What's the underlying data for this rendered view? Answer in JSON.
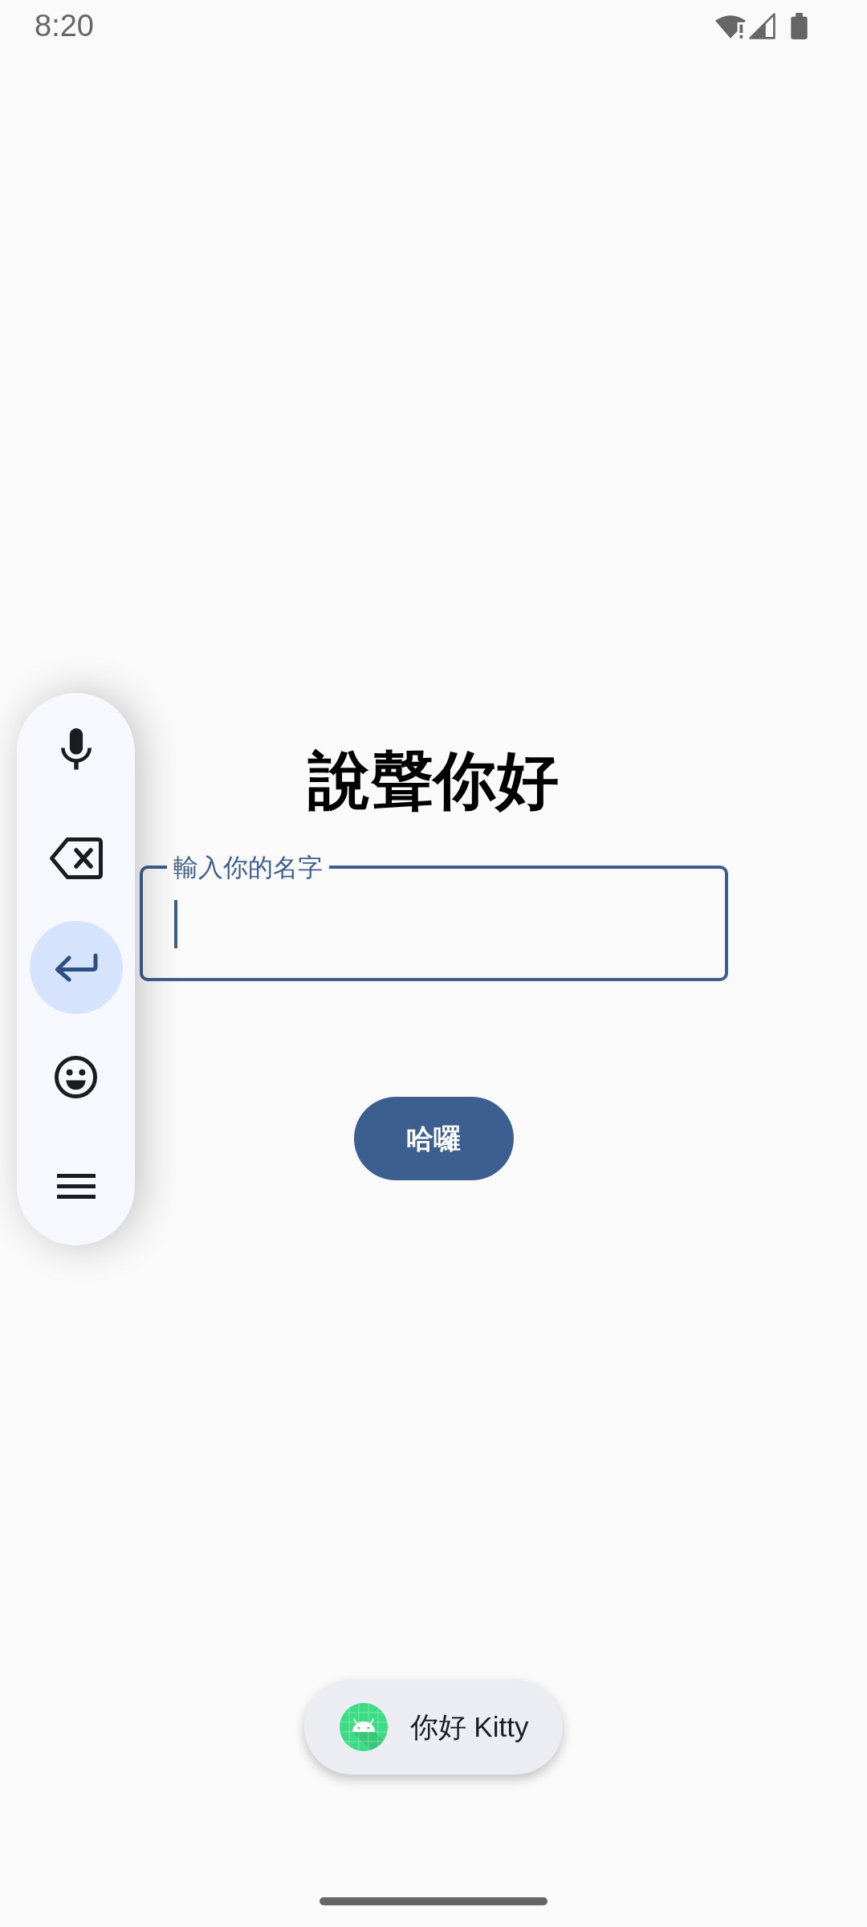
{
  "status_bar": {
    "time": "8:20"
  },
  "floating_toolbar": {
    "buttons": [
      {
        "kind": "mic",
        "selected": false
      },
      {
        "kind": "backspace",
        "selected": false
      },
      {
        "kind": "enter",
        "selected": true
      },
      {
        "kind": "emoji",
        "selected": false
      },
      {
        "kind": "menu",
        "selected": false
      }
    ]
  },
  "title": "說聲你好",
  "name_field": {
    "label": "輸入你的名字",
    "focused": true
  },
  "greet_button": {
    "label": "哈囉"
  },
  "toast": {
    "text": "你好 Kitty"
  }
}
